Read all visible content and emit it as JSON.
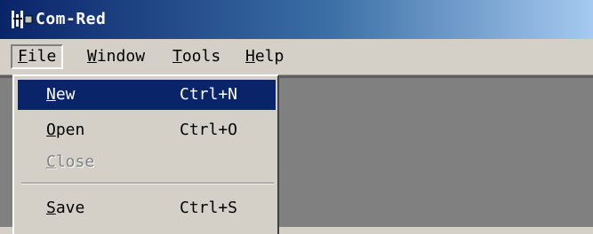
{
  "window": {
    "title": "Com-Red",
    "icon": "app-logo-icon"
  },
  "menubar": {
    "items": [
      {
        "label": "File",
        "mnemonic": "F",
        "rest": "ile"
      },
      {
        "label": "Window",
        "mnemonic": "W",
        "rest": "indow"
      },
      {
        "label": "Tools",
        "mnemonic": "T",
        "rest": "ools"
      },
      {
        "label": "Help",
        "mnemonic": "H",
        "rest": "elp"
      }
    ]
  },
  "file_menu": {
    "items": [
      {
        "label": "New",
        "mnemonic": "N",
        "rest": "ew",
        "shortcut": "Ctrl+N",
        "state": "selected"
      },
      {
        "label": "Open",
        "mnemonic": "O",
        "rest": "pen",
        "shortcut": "Ctrl+O",
        "state": "enabled"
      },
      {
        "label": "Close",
        "mnemonic": "C",
        "rest": "lose",
        "shortcut": "",
        "state": "disabled"
      },
      {
        "label": "Save",
        "mnemonic": "S",
        "rest": "ave",
        "shortcut": "Ctrl+S",
        "state": "enabled"
      }
    ]
  },
  "colors": {
    "title_bar_start": "#0a246a",
    "title_bar_end": "#a6caf0",
    "menu_face": "#d4d0c8",
    "highlight": "#0a246a",
    "workspace": "#808080"
  }
}
